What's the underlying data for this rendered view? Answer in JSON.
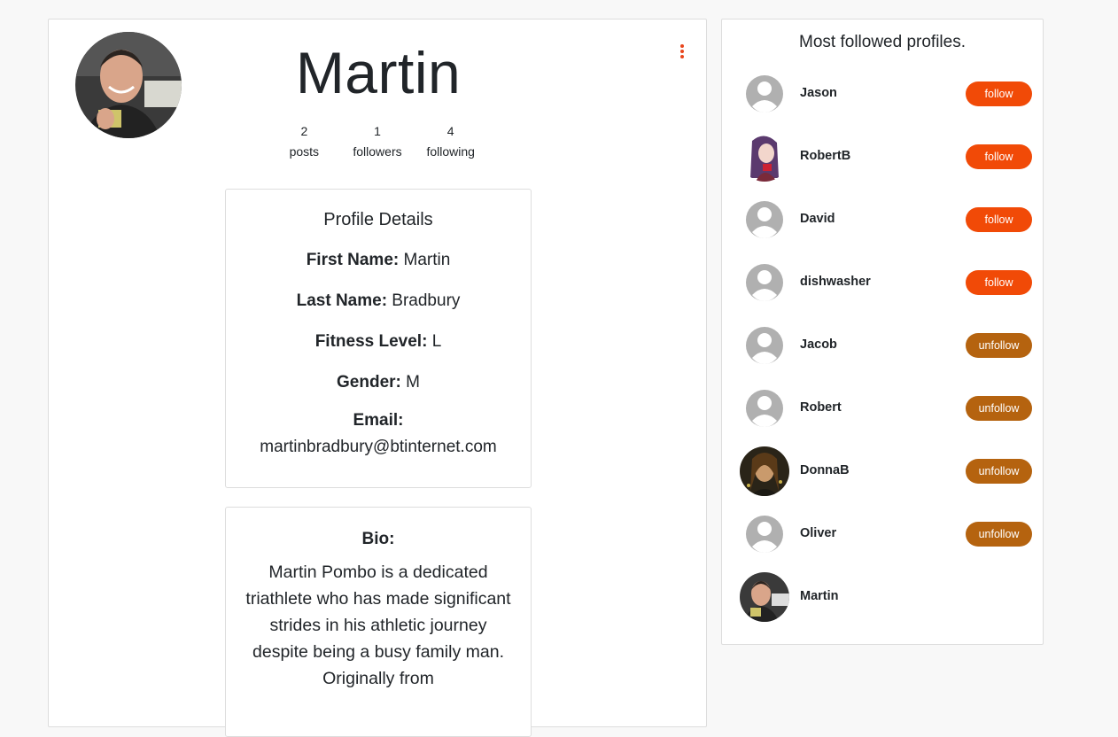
{
  "profile": {
    "name": "Martin",
    "stats": [
      {
        "value": "2",
        "label": "posts"
      },
      {
        "value": "1",
        "label": "followers"
      },
      {
        "value": "4",
        "label": "following"
      }
    ]
  },
  "details": {
    "title": "Profile Details",
    "first_name_label": "First Name:",
    "first_name": "Martin",
    "last_name_label": "Last Name:",
    "last_name": "Bradbury",
    "fitness_label": "Fitness Level:",
    "fitness": "L",
    "gender_label": "Gender:",
    "gender": "M",
    "email_label": "Email:",
    "email": "martinbradbury@btinternet.com"
  },
  "bio": {
    "title": "Bio:",
    "text": "Martin Pombo is a dedicated triathlete who has made significant strides in his athletic journey despite being a busy family man. Originally from"
  },
  "sidebar": {
    "title": "Most followed profiles.",
    "profiles": [
      {
        "name": "Jason",
        "action": "follow",
        "avatar": "default-avatar"
      },
      {
        "name": "RobertB",
        "action": "follow",
        "avatar": "anime-avatar"
      },
      {
        "name": "David",
        "action": "follow",
        "avatar": "default-avatar"
      },
      {
        "name": "dishwasher",
        "action": "follow",
        "avatar": "default-avatar"
      },
      {
        "name": "Jacob",
        "action": "unfollow",
        "avatar": "default-avatar"
      },
      {
        "name": "Robert",
        "action": "unfollow",
        "avatar": "default-avatar"
      },
      {
        "name": "DonnaB",
        "action": "unfollow",
        "avatar": "photo-avatar"
      },
      {
        "name": "Oliver",
        "action": "unfollow",
        "avatar": "default-avatar"
      },
      {
        "name": "Martin",
        "action": "",
        "avatar": "photo-avatar"
      }
    ]
  },
  "colors": {
    "follow": "#f14a07",
    "unfollow": "#b5630f",
    "accent": "#e8461c"
  }
}
